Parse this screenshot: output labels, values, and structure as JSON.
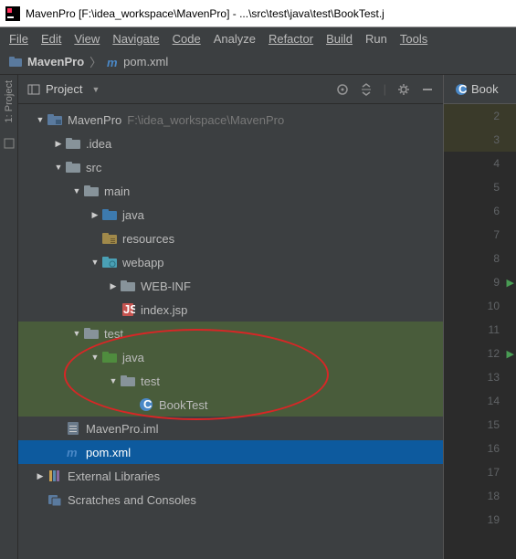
{
  "title": "MavenPro [F:\\idea_workspace\\MavenPro] - ...\\src\\test\\java\\test\\BookTest.j",
  "menu": [
    "File",
    "Edit",
    "View",
    "Navigate",
    "Code",
    "Analyze",
    "Refactor",
    "Build",
    "Run",
    "Tools"
  ],
  "breadcrumb": {
    "project": "MavenPro",
    "file": "pom.xml"
  },
  "panel": {
    "title": "Project"
  },
  "left_rail": {
    "label": "1: Project"
  },
  "editor": {
    "tab_label": "Book",
    "line_start": 2,
    "line_end": 19,
    "run_lines": [
      9,
      12
    ],
    "hl_lines": [
      2,
      3
    ]
  },
  "tree": [
    {
      "indent": 0,
      "arrow": "down",
      "icon": "folder-project",
      "label": "MavenPro",
      "dim": "F:\\idea_workspace\\MavenPro"
    },
    {
      "indent": 1,
      "arrow": "right",
      "icon": "folder",
      "label": ".idea"
    },
    {
      "indent": 1,
      "arrow": "down",
      "icon": "folder",
      "label": "src"
    },
    {
      "indent": 2,
      "arrow": "down",
      "icon": "folder",
      "label": "main"
    },
    {
      "indent": 3,
      "arrow": "right",
      "icon": "folder-java",
      "label": "java"
    },
    {
      "indent": 3,
      "arrow": "none",
      "icon": "folder-res",
      "label": "resources"
    },
    {
      "indent": 3,
      "arrow": "down",
      "icon": "folder-web",
      "label": "webapp"
    },
    {
      "indent": 4,
      "arrow": "right",
      "icon": "folder",
      "label": "WEB-INF"
    },
    {
      "indent": 4,
      "arrow": "none",
      "icon": "jsp",
      "label": "index.jsp"
    },
    {
      "indent": 2,
      "arrow": "down",
      "icon": "folder",
      "label": "test",
      "green": true
    },
    {
      "indent": 3,
      "arrow": "down",
      "icon": "folder-test",
      "label": "java",
      "green": true
    },
    {
      "indent": 4,
      "arrow": "down",
      "icon": "folder",
      "label": "test",
      "green": true
    },
    {
      "indent": 5,
      "arrow": "none",
      "icon": "class",
      "label": "BookTest",
      "green": true
    },
    {
      "indent": 1,
      "arrow": "none",
      "icon": "iml",
      "label": "MavenPro.iml"
    },
    {
      "indent": 1,
      "arrow": "none",
      "icon": "maven",
      "label": "pom.xml",
      "selected": true
    },
    {
      "indent": 0,
      "arrow": "right",
      "icon": "lib",
      "label": "External Libraries"
    },
    {
      "indent": 0,
      "arrow": "none",
      "icon": "scratch",
      "label": "Scratches and Consoles"
    }
  ]
}
